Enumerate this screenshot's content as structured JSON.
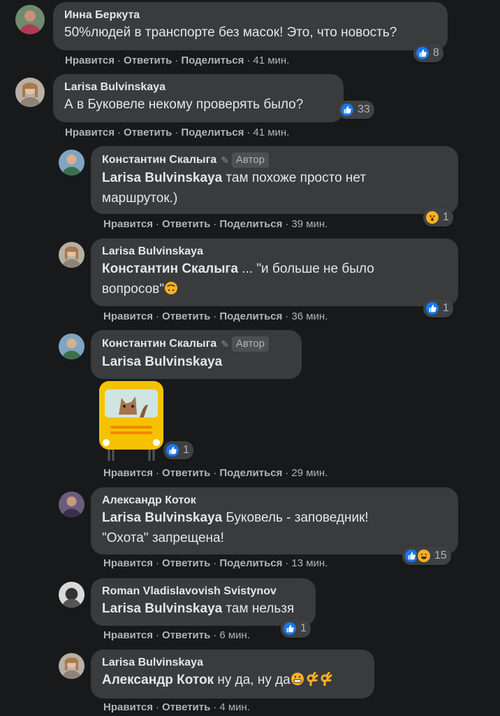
{
  "ui": {
    "like": "Нравится",
    "reply": "Ответить",
    "share": "Поделиться",
    "author_label": "Автор",
    "sep": "·"
  },
  "comments": [
    {
      "name": "Инна Беркута",
      "text": "50%людей в транспорте без масок! Это, что новость?",
      "time": "41 мин.",
      "reactions": [
        "like"
      ],
      "count": "8"
    },
    {
      "name": "Larisa Bulvinskaya",
      "text": "А в Буковеле некому проверять было?",
      "time": "41 мин.",
      "reactions": [
        "like"
      ],
      "count": "33"
    },
    {
      "name": "Константин Скалыга",
      "mention": "Larisa Bulvinskaya",
      "text_line1": " там похоже просто нет",
      "text_line2": "маршруток.)",
      "time": "39 мин.",
      "reactions": [
        "wow"
      ],
      "count": "1"
    },
    {
      "name": "Larisa Bulvinskaya",
      "mention": "Константин Скалыга",
      "text_line1": " ... \"и больше не было",
      "text_line2": "вопросов\"",
      "time": "36 мин.",
      "reactions": [
        "like"
      ],
      "count": "1"
    },
    {
      "name": "Константин Скалыга",
      "mention": "Larisa Bulvinskaya",
      "time": "29 мин.",
      "reactions": [
        "like"
      ],
      "count": "1"
    },
    {
      "name": "Александр Коток",
      "mention": "Larisa Bulvinskaya",
      "text_line1": " Буковель - заповедник!",
      "text_line2": "\"Охота\" запрещена!",
      "time": "13 мин.",
      "reactions": [
        "like",
        "haha"
      ],
      "count": "15"
    },
    {
      "name": "Roman Vladislavovish Svistynov",
      "mention": "Larisa Bulvinskaya",
      "text": " там нельзя",
      "time": "6 мин.",
      "reactions": [
        "like"
      ],
      "count": "1"
    },
    {
      "name": "Larisa Bulvinskaya",
      "mention": "Александр Коток",
      "text": " ну да, ну да",
      "time": "4 мин."
    }
  ],
  "colors": {
    "background": "#18191a",
    "bubble": "#3a3b3c",
    "like_blue": "#1877f2",
    "emoji_yellow": "#f7b125",
    "bus_yellow": "#f6c200"
  }
}
